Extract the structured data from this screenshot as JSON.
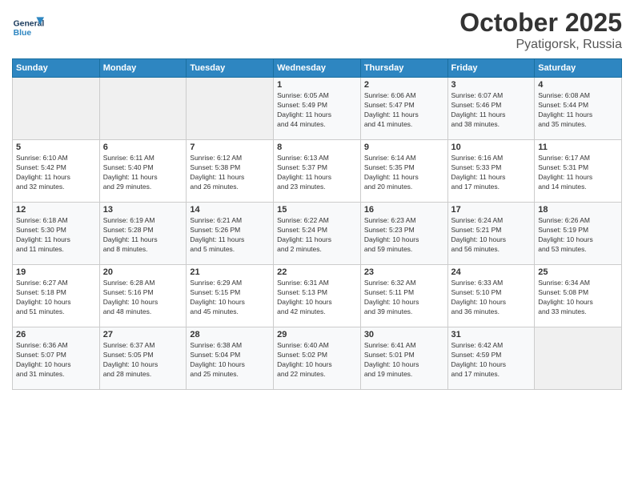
{
  "header": {
    "logo_general": "General",
    "logo_blue": "Blue",
    "month": "October 2025",
    "location": "Pyatigorsk, Russia"
  },
  "weekdays": [
    "Sunday",
    "Monday",
    "Tuesday",
    "Wednesday",
    "Thursday",
    "Friday",
    "Saturday"
  ],
  "weeks": [
    [
      {
        "day": "",
        "info": ""
      },
      {
        "day": "",
        "info": ""
      },
      {
        "day": "",
        "info": ""
      },
      {
        "day": "1",
        "info": "Sunrise: 6:05 AM\nSunset: 5:49 PM\nDaylight: 11 hours\nand 44 minutes."
      },
      {
        "day": "2",
        "info": "Sunrise: 6:06 AM\nSunset: 5:47 PM\nDaylight: 11 hours\nand 41 minutes."
      },
      {
        "day": "3",
        "info": "Sunrise: 6:07 AM\nSunset: 5:46 PM\nDaylight: 11 hours\nand 38 minutes."
      },
      {
        "day": "4",
        "info": "Sunrise: 6:08 AM\nSunset: 5:44 PM\nDaylight: 11 hours\nand 35 minutes."
      }
    ],
    [
      {
        "day": "5",
        "info": "Sunrise: 6:10 AM\nSunset: 5:42 PM\nDaylight: 11 hours\nand 32 minutes."
      },
      {
        "day": "6",
        "info": "Sunrise: 6:11 AM\nSunset: 5:40 PM\nDaylight: 11 hours\nand 29 minutes."
      },
      {
        "day": "7",
        "info": "Sunrise: 6:12 AM\nSunset: 5:38 PM\nDaylight: 11 hours\nand 26 minutes."
      },
      {
        "day": "8",
        "info": "Sunrise: 6:13 AM\nSunset: 5:37 PM\nDaylight: 11 hours\nand 23 minutes."
      },
      {
        "day": "9",
        "info": "Sunrise: 6:14 AM\nSunset: 5:35 PM\nDaylight: 11 hours\nand 20 minutes."
      },
      {
        "day": "10",
        "info": "Sunrise: 6:16 AM\nSunset: 5:33 PM\nDaylight: 11 hours\nand 17 minutes."
      },
      {
        "day": "11",
        "info": "Sunrise: 6:17 AM\nSunset: 5:31 PM\nDaylight: 11 hours\nand 14 minutes."
      }
    ],
    [
      {
        "day": "12",
        "info": "Sunrise: 6:18 AM\nSunset: 5:30 PM\nDaylight: 11 hours\nand 11 minutes."
      },
      {
        "day": "13",
        "info": "Sunrise: 6:19 AM\nSunset: 5:28 PM\nDaylight: 11 hours\nand 8 minutes."
      },
      {
        "day": "14",
        "info": "Sunrise: 6:21 AM\nSunset: 5:26 PM\nDaylight: 11 hours\nand 5 minutes."
      },
      {
        "day": "15",
        "info": "Sunrise: 6:22 AM\nSunset: 5:24 PM\nDaylight: 11 hours\nand 2 minutes."
      },
      {
        "day": "16",
        "info": "Sunrise: 6:23 AM\nSunset: 5:23 PM\nDaylight: 10 hours\nand 59 minutes."
      },
      {
        "day": "17",
        "info": "Sunrise: 6:24 AM\nSunset: 5:21 PM\nDaylight: 10 hours\nand 56 minutes."
      },
      {
        "day": "18",
        "info": "Sunrise: 6:26 AM\nSunset: 5:19 PM\nDaylight: 10 hours\nand 53 minutes."
      }
    ],
    [
      {
        "day": "19",
        "info": "Sunrise: 6:27 AM\nSunset: 5:18 PM\nDaylight: 10 hours\nand 51 minutes."
      },
      {
        "day": "20",
        "info": "Sunrise: 6:28 AM\nSunset: 5:16 PM\nDaylight: 10 hours\nand 48 minutes."
      },
      {
        "day": "21",
        "info": "Sunrise: 6:29 AM\nSunset: 5:15 PM\nDaylight: 10 hours\nand 45 minutes."
      },
      {
        "day": "22",
        "info": "Sunrise: 6:31 AM\nSunset: 5:13 PM\nDaylight: 10 hours\nand 42 minutes."
      },
      {
        "day": "23",
        "info": "Sunrise: 6:32 AM\nSunset: 5:11 PM\nDaylight: 10 hours\nand 39 minutes."
      },
      {
        "day": "24",
        "info": "Sunrise: 6:33 AM\nSunset: 5:10 PM\nDaylight: 10 hours\nand 36 minutes."
      },
      {
        "day": "25",
        "info": "Sunrise: 6:34 AM\nSunset: 5:08 PM\nDaylight: 10 hours\nand 33 minutes."
      }
    ],
    [
      {
        "day": "26",
        "info": "Sunrise: 6:36 AM\nSunset: 5:07 PM\nDaylight: 10 hours\nand 31 minutes."
      },
      {
        "day": "27",
        "info": "Sunrise: 6:37 AM\nSunset: 5:05 PM\nDaylight: 10 hours\nand 28 minutes."
      },
      {
        "day": "28",
        "info": "Sunrise: 6:38 AM\nSunset: 5:04 PM\nDaylight: 10 hours\nand 25 minutes."
      },
      {
        "day": "29",
        "info": "Sunrise: 6:40 AM\nSunset: 5:02 PM\nDaylight: 10 hours\nand 22 minutes."
      },
      {
        "day": "30",
        "info": "Sunrise: 6:41 AM\nSunset: 5:01 PM\nDaylight: 10 hours\nand 19 minutes."
      },
      {
        "day": "31",
        "info": "Sunrise: 6:42 AM\nSunset: 4:59 PM\nDaylight: 10 hours\nand 17 minutes."
      },
      {
        "day": "",
        "info": ""
      }
    ]
  ]
}
